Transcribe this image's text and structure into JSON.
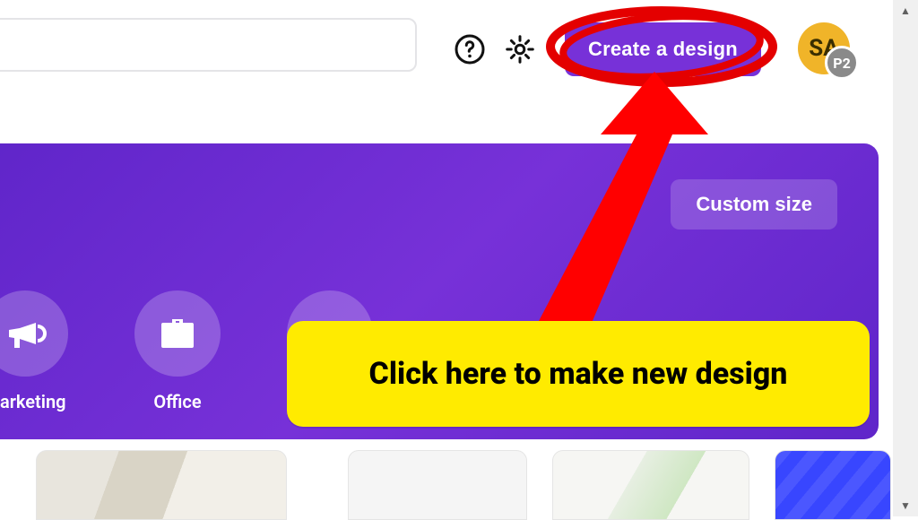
{
  "header": {
    "create_label": "Create a design",
    "avatar_initials": "SA",
    "avatar_badge": "P2"
  },
  "hero": {
    "custom_size_label": "Custom size",
    "categories": [
      {
        "icon": "megaphone-icon",
        "label": "Marketing"
      },
      {
        "icon": "briefcase-icon",
        "label": "Office"
      },
      {
        "icon": "more-icon",
        "label": ""
      }
    ]
  },
  "annotation": {
    "callout_text": "Click here to make new design"
  }
}
